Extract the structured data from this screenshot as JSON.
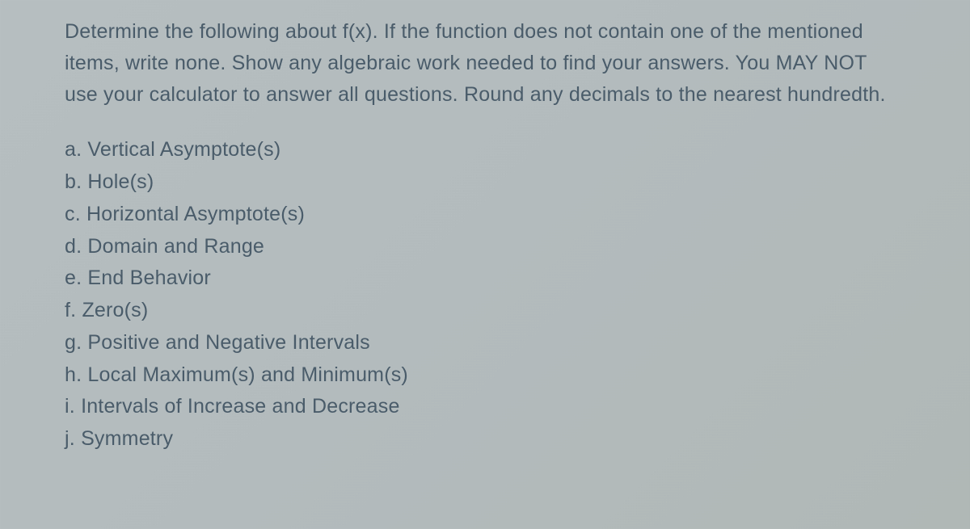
{
  "instructions": "Determine the following about f(x). If the function does not contain one of the mentioned items, write none. Show any algebraic work needed to find your answers. You MAY NOT use your calculator to answer all questions. Round any decimals to the nearest hundredth.",
  "items": [
    {
      "label": "a.",
      "text": "Vertical Asymptote(s)"
    },
    {
      "label": "b.",
      "text": "Hole(s)"
    },
    {
      "label": "c.",
      "text": "Horizontal Asymptote(s)"
    },
    {
      "label": "d.",
      "text": "Domain and Range"
    },
    {
      "label": "e.",
      "text": "End Behavior"
    },
    {
      "label": "f.",
      "text": "Zero(s)"
    },
    {
      "label": "g.",
      "text": "Positive and Negative Intervals"
    },
    {
      "label": "h.",
      "text": "Local Maximum(s) and Minimum(s)"
    },
    {
      "label": "i.",
      "text": "Intervals of Increase and Decrease"
    },
    {
      "label": "j.",
      "text": "Symmetry"
    }
  ]
}
